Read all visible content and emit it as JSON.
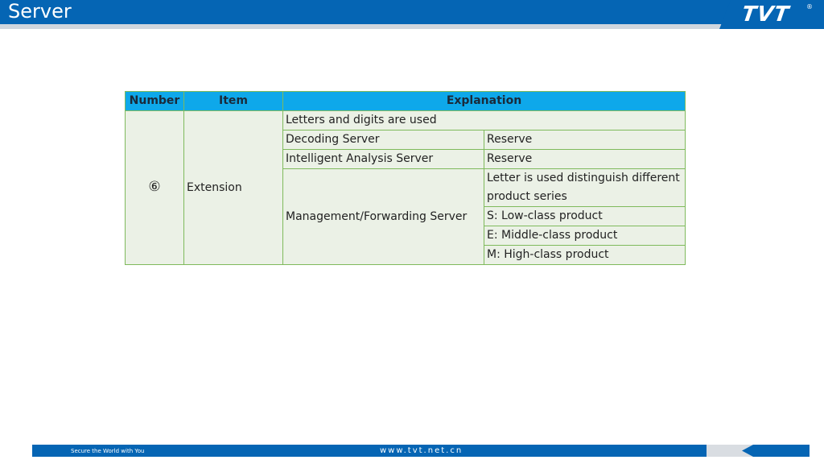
{
  "header": {
    "title": "Server",
    "logo_text": "TVT",
    "logo_mark": "®"
  },
  "table": {
    "headers": {
      "number": "Number",
      "item": "Item",
      "explanation": "Explanation"
    },
    "number_value": "⑥",
    "item_value": "Extension",
    "rows": {
      "letters_digits": "Letters and digits are used",
      "decoding_server": "Decoding Server",
      "decoding_reserve": "Reserve",
      "intelligent_server": "Intelligent Analysis Server",
      "intelligent_reserve": "Reserve",
      "management_server": "Management/Forwarding Server",
      "letter_distinguish": "Letter is used distinguish different product series",
      "s_low": "S: Low-class product",
      "e_middle": "E: Middle-class product",
      "m_high": "M: High-class product"
    }
  },
  "footer": {
    "slogan": "Secure the World with You",
    "url": "www.tvt.net.cn"
  },
  "colors": {
    "brand_blue": "#0565b4",
    "table_header": "#0ea8ea",
    "table_border": "#7fba5c",
    "table_cell": "#ebf1e6"
  }
}
